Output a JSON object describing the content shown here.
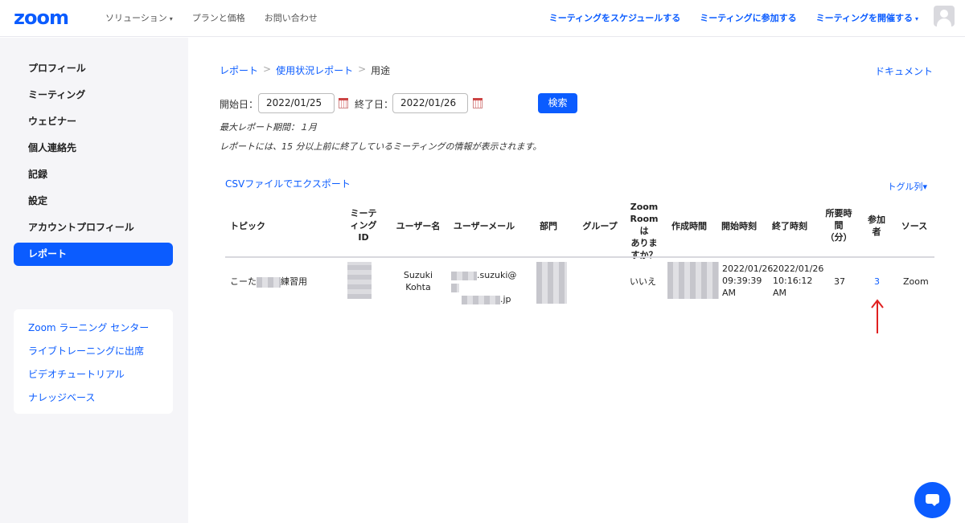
{
  "header": {
    "logo": "zoom",
    "nav_left": [
      {
        "label": "ソリューション",
        "caret": "▾"
      },
      {
        "label": "プランと価格"
      },
      {
        "label": "お問い合わせ"
      }
    ],
    "nav_right": [
      {
        "label": "ミーティングをスケジュールする"
      },
      {
        "label": "ミーティングに参加する"
      },
      {
        "label": "ミーティングを開催する",
        "caret": "▾"
      }
    ]
  },
  "sidebar": {
    "items": [
      {
        "label": "プロフィール"
      },
      {
        "label": "ミーティング"
      },
      {
        "label": "ウェビナー"
      },
      {
        "label": "個人連絡先"
      },
      {
        "label": "記録"
      },
      {
        "label": "設定"
      },
      {
        "label": "アカウントプロフィール"
      },
      {
        "label": "レポート",
        "active": true
      }
    ],
    "learn_links": [
      {
        "label": "Zoom ラーニング センター"
      },
      {
        "label": "ライブトレーニングに出席"
      },
      {
        "label": "ビデオチュートリアル"
      },
      {
        "label": "ナレッジベース"
      }
    ]
  },
  "breadcrumb": {
    "items": [
      "レポート",
      "使用状況レポート",
      "用途"
    ],
    "separator": ">"
  },
  "doc_link": "ドキュメント",
  "filters": {
    "start_label": "開始日：",
    "start_value": "2022/01/25",
    "end_label": "終了日：",
    "end_value": "2022/01/26",
    "search_button": "検索",
    "note1": "最大レポート期間：１月",
    "note2": "レポートには、15 分以上前に終了しているミーティングの情報が表示されます。"
  },
  "csv_export": "CSVファイルでエクスポート",
  "toggle_columns": "トグル列▾",
  "table": {
    "columns": [
      "トピック",
      "ミーティングID",
      "ユーザー名",
      "ユーザーメール",
      "部門",
      "グループ",
      "Zoom Roomはありますか？",
      "作成時間",
      "開始時刻",
      "終了時刻",
      "所要時間（分）",
      "参加者",
      "ソース"
    ],
    "header_lines": {
      "topic": [
        "トピック"
      ],
      "meeting_id": [
        "ミーテ",
        "ィング",
        "ID"
      ],
      "user_name": [
        "ユーザー名"
      ],
      "user_email": [
        "ユーザーメール"
      ],
      "department": [
        "部門"
      ],
      "group": [
        "グループ"
      ],
      "zoom_room": [
        "Zoom",
        "Roomは",
        "ありま",
        "すか？"
      ],
      "created": [
        "作成時間"
      ],
      "start": [
        "開始時刻"
      ],
      "end": [
        "終了時刻"
      ],
      "duration": [
        "所要時",
        "間",
        "（分）"
      ],
      "participants": [
        "参加",
        "者"
      ],
      "source": [
        "ソース"
      ]
    },
    "row": {
      "topic_prefix": "こーた",
      "topic_suffix": "練習用",
      "user_name": [
        "Suzuki",
        "Kohta"
      ],
      "email_part1": ".suzuki@",
      "email_part2": ".jp",
      "zoom_room": "いいえ",
      "start": [
        "2022/01/26",
        "09:39:39",
        "AM"
      ],
      "end": [
        "2022/01/26",
        "10:16:12",
        "AM"
      ],
      "duration": "37",
      "participants": "3",
      "source": "Zoom"
    }
  },
  "colors": {
    "brand": "#0b5cff",
    "annotation_arrow": "#e02020"
  }
}
